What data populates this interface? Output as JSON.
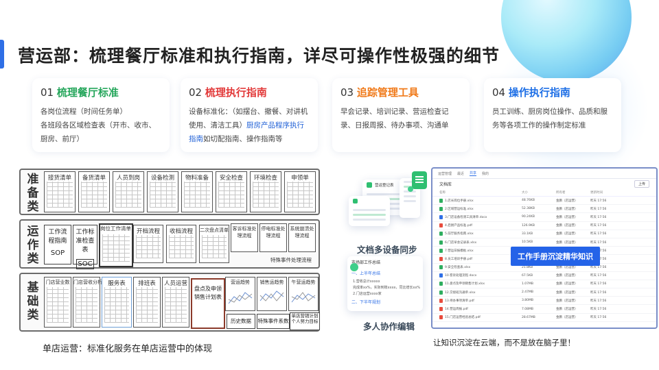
{
  "title": "营运部：梳理餐厅标准和执行指南，详尽可操作性极强的细节",
  "cards": [
    {
      "num": "01 ",
      "head": "梳理餐厅标准",
      "color": "green",
      "lines": [
        "各岗位流程（时间任务单）",
        "各班段各区域检查表（开市、收市、厨房、前厅）"
      ]
    },
    {
      "num": "02 ",
      "head": "梳理执行指南",
      "color": "red",
      "text_a": "设备标准化：（如摆台、撤餐、对讲机使用、清洁工具）",
      "text_link": "厨房产品程序执行指南",
      "text_b": "如切配指南、操作指南等"
    },
    {
      "num": "03 ",
      "head": "追踪管理工具",
      "color": "orange",
      "lines": [
        "早会记录、培训记录、营运检查记录、日报周报、待办事项、沟通单"
      ]
    },
    {
      "num": "04 ",
      "head": "操作执行指南",
      "color": "blue",
      "lines": [
        "员工训练、厨房岗位操作、品质和服务等各项工作的操作制定标准"
      ]
    }
  ],
  "diagram": {
    "rows": [
      {
        "label": [
          "准",
          "备",
          "类"
        ],
        "boxes": [
          "接货清单",
          "备货清单",
          "人员到岗",
          "设备检测",
          "物料准备",
          "安全检查",
          "环境检查",
          "申领单"
        ]
      },
      {
        "label": [
          "运",
          "作",
          "类"
        ],
        "boxes": [
          "工作流程指南",
          "工作标准检查表",
          "岗位工作清单",
          "开档流程",
          "收档流程",
          "二次盘点清单",
          "客诉标准处理流程",
          "停电标准处理流程",
          "系统崩溃处理流程"
        ],
        "tags": [
          "SOP",
          "SOC"
        ],
        "note": "特殊事件处理流程"
      },
      {
        "label": [
          "基",
          "础",
          "类"
        ],
        "boxes": [
          "门店营业数",
          "门店营收分析",
          "服务表",
          "排班表",
          "人员运营",
          "盘点及申领销售计划表",
          "营运趋势",
          "销售运趋势",
          "午营运趋势"
        ],
        "extra": [
          "历史数据",
          "特殊事件系数",
          "单店营销计划个人努力目标"
        ]
      }
    ],
    "caption": "单店运营：标准化服务在单店运营中的体现"
  },
  "devices": {
    "sync_label": "文档多设备同步",
    "collab_label": "多人协作编辑",
    "tablet_title": "营运登记表",
    "editor": {
      "title": "市场部工作总结",
      "h1": "一、上半年总结",
      "lines": [
        "1.营收总计xxxxx",
        "完成率xx%，实际到账xxxx，同比增长xx%",
        "2.门店运营xxxx家"
      ],
      "h2": "二、下半年规划"
    }
  },
  "screenshot": {
    "tabs": [
      "运营管理",
      "最近",
      "共享",
      "我的"
    ],
    "active_tab": 2,
    "folder": "文档库",
    "upload": "上传",
    "columns": [
      "名称",
      "大小",
      "所有者",
      "更新时间"
    ],
    "files": [
      {
        "name": "1.店长岗位手册.xlsx",
        "size": "48.76KB",
        "color": "#2fae5f"
      },
      {
        "name": "2.区域营运标准.xlsx",
        "size": "52.38KB",
        "color": "#2fae5f"
      },
      {
        "name": "3.门店设备检测工具清单.docx",
        "size": "90.24KB",
        "color": "#2f6fe6"
      },
      {
        "name": "4.后厨产品标准.pdf",
        "size": "126.9KB",
        "color": "#e84c3d"
      },
      {
        "name": "5.前厅服务指南.xlsx",
        "size": "33.1KB",
        "color": "#2fae5f"
      },
      {
        "name": "6.门店早会记录表.xlsx",
        "size": "10.5KB",
        "color": "#2fae5f"
      },
      {
        "name": "7.营运日报模板.xlsx",
        "size": "44.2KB",
        "color": "#2fae5f"
      },
      {
        "name": "8.员工培训手册.pdf",
        "size": "3.21MB",
        "color": "#e84c3d"
      },
      {
        "name": "9.安全检查表.xlsx",
        "size": "21.8KB",
        "color": "#2fae5f"
      },
      {
        "name": "10.客诉处理流程.docx",
        "size": "67.5KB",
        "color": "#2f6fe6"
      },
      {
        "name": "11.盘点及申领销售计划.xlsx",
        "size": "1.07MB",
        "color": "#2fae5f"
      },
      {
        "name": "12.交接班沟通单.xlsx",
        "size": "2.47MB",
        "color": "#2fae5f"
      },
      {
        "name": "13.待办事项清单.pdf",
        "size": "3.80MB",
        "color": "#e84c3d"
      },
      {
        "name": "14.营运周报.pdf",
        "size": "7.08MB",
        "color": "#e84c3d"
      },
      {
        "name": "15.门店运营经验总结.pdf",
        "size": "28.67MB",
        "color": "#e84c3d"
      }
    ],
    "owner": "金鹏（店运营）",
    "updated": "昨天 17:56",
    "tag": "工作手册沉淀精华知识",
    "caption": "让知识沉淀在云端，而不是放在脑子里！"
  }
}
